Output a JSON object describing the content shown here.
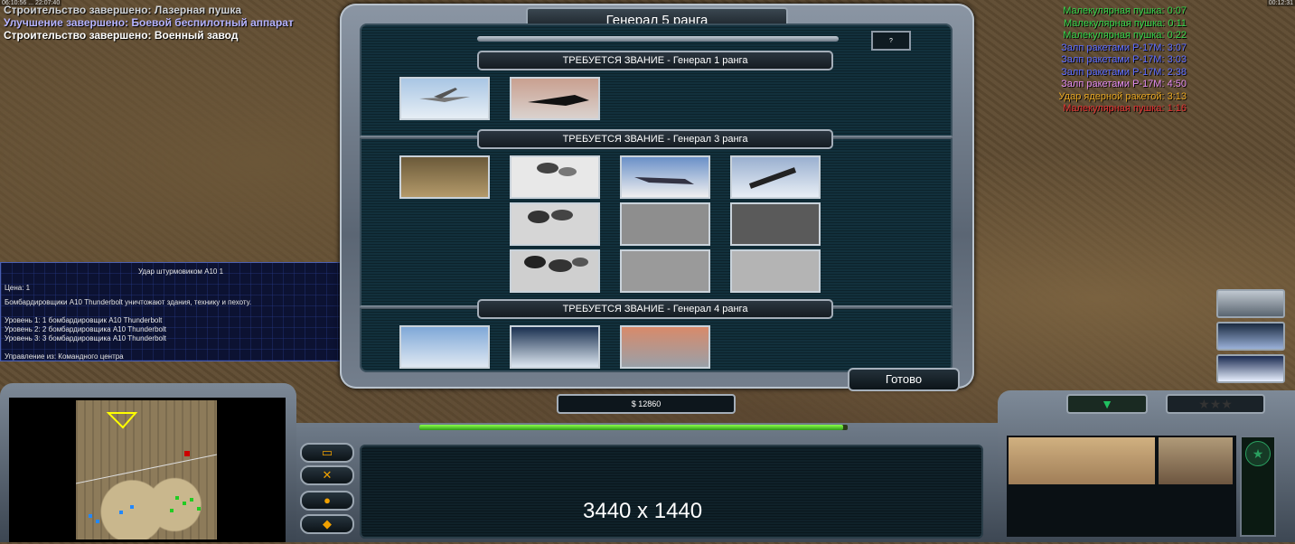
{
  "messages": [
    "Строительство завершено: Лазерная пушка",
    "Улучшение завершено: Боевой беспилотный аппарат",
    "Строительство завершено: Военный завод"
  ],
  "clock": {
    "left": "06:10:56 ... 22:07:40",
    "right": "00:12:31"
  },
  "timers": [
    {
      "text": "Малекулярная пушка: 0:07",
      "color": "#34d34a"
    },
    {
      "text": "Малекулярная пушка: 0:11",
      "color": "#34d34a"
    },
    {
      "text": "Малекулярная пушка: 0:22",
      "color": "#34d34a"
    },
    {
      "text": "Залп ракетами Р-17М: 3:07",
      "color": "#5b6bff"
    },
    {
      "text": "Залп ракетами Р-17М: 3:03",
      "color": "#5b6bff"
    },
    {
      "text": "Залп ракетами Р-17М: 2:38",
      "color": "#5b6bff"
    },
    {
      "text": "Залп ракетами Р-17М: 4:50",
      "color": "#e48cf0"
    },
    {
      "text": "Удар ядерной ракетой: 3:13",
      "color": "#e8a722"
    },
    {
      "text": "Малекулярная пушка: 1:16",
      "color": "#e03030"
    }
  ],
  "tooltip": {
    "title": "Удар штурмовиком А10 1",
    "cost": "Цена: 1",
    "description": "Бомбардировщики А10 Thunderbolt уничтожают здания, технику и пехоту.",
    "levels": [
      "Уровень 1: 1 бомбардировщик А10 Thunderbolt",
      "Уровень 2: 2 бомбардировщика А10 Thunderbolt",
      "Уровень 3: 3 бомбардировщика А10 Thunderbolt"
    ],
    "control": "Управление из: Командного центра"
  },
  "dialog": {
    "title": "Генерал 5 ранга",
    "points": "?",
    "sections": [
      {
        "label": "ТРЕБУЕТСЯ ЗВАНИЕ - Генерал 1 ранга"
      },
      {
        "label": "ТРЕБУЕТСЯ ЗВАНИЕ - Генерал 3 ранга"
      },
      {
        "label": "ТРЕБУЕТСЯ ЗВАНИЕ - Генерал 4 ранга"
      }
    ],
    "done_label": "Готово"
  },
  "money": "$ 12860",
  "power_level": 0.99,
  "resolution_overlay": "3440 x 1440",
  "colors": {
    "panel": "#12303c",
    "frame": "#7c8896",
    "power": "#6ae63a"
  },
  "icons": [
    "build-icon",
    "tools-icon",
    "alert-icon",
    "chat-icon",
    "triangle-down-icon",
    "rank-stars-icon",
    "general-emblem-icon"
  ]
}
